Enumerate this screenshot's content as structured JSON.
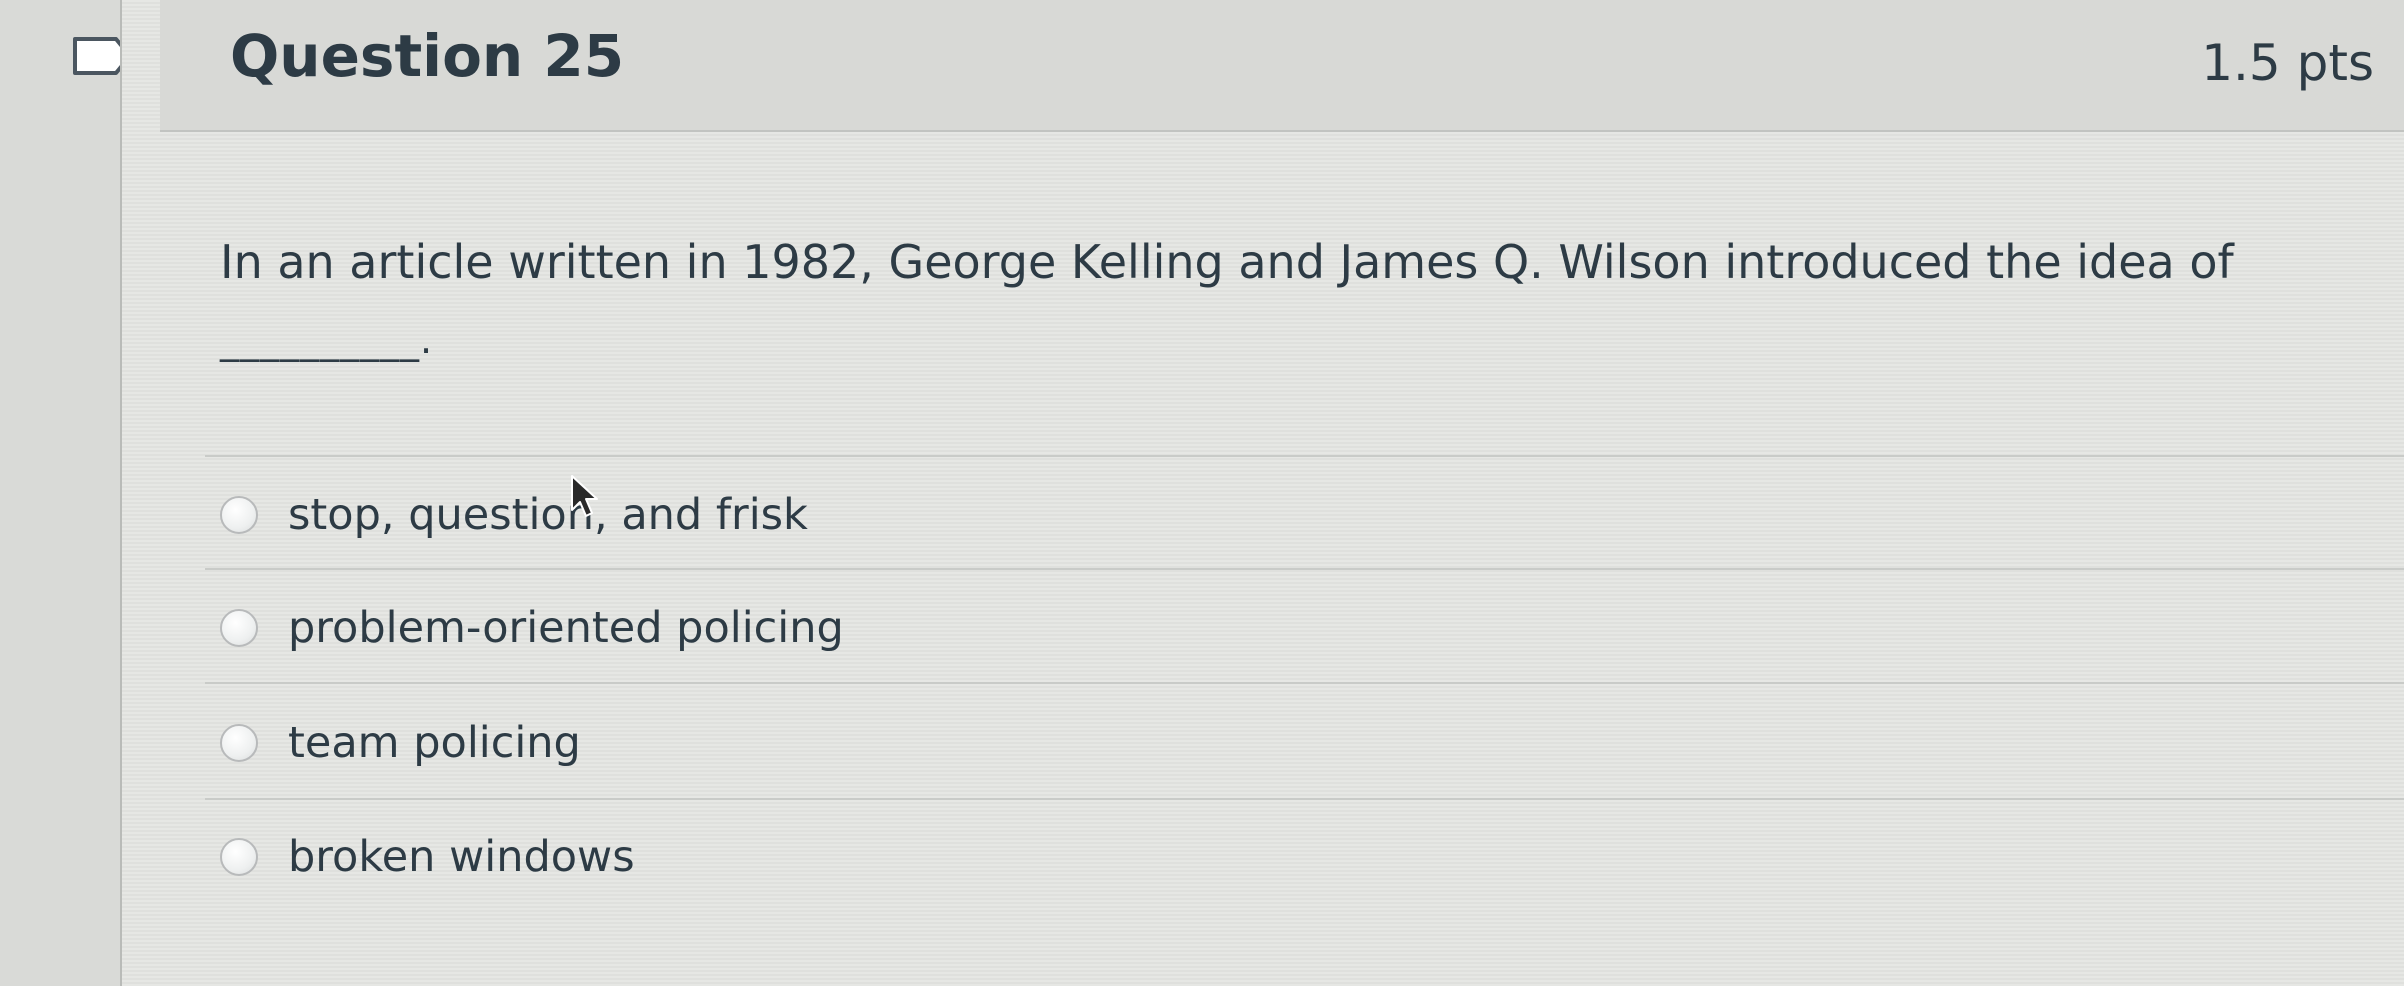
{
  "question": {
    "title": "Question 25",
    "points": "1.5 pts",
    "stem": "In an article written in 1982, George Kelling and James Q. Wilson introduced the idea of",
    "blank": "__________.",
    "flag_icon": "flag-outline-icon",
    "answers": [
      {
        "label": "stop, question, and frisk"
      },
      {
        "label": "problem-oriented policing"
      },
      {
        "label": "team policing"
      },
      {
        "label": "broken windows"
      }
    ]
  },
  "colors": {
    "text": "#2d3b45",
    "background": "#e3e4e1",
    "divider": "#c9cbc8"
  }
}
